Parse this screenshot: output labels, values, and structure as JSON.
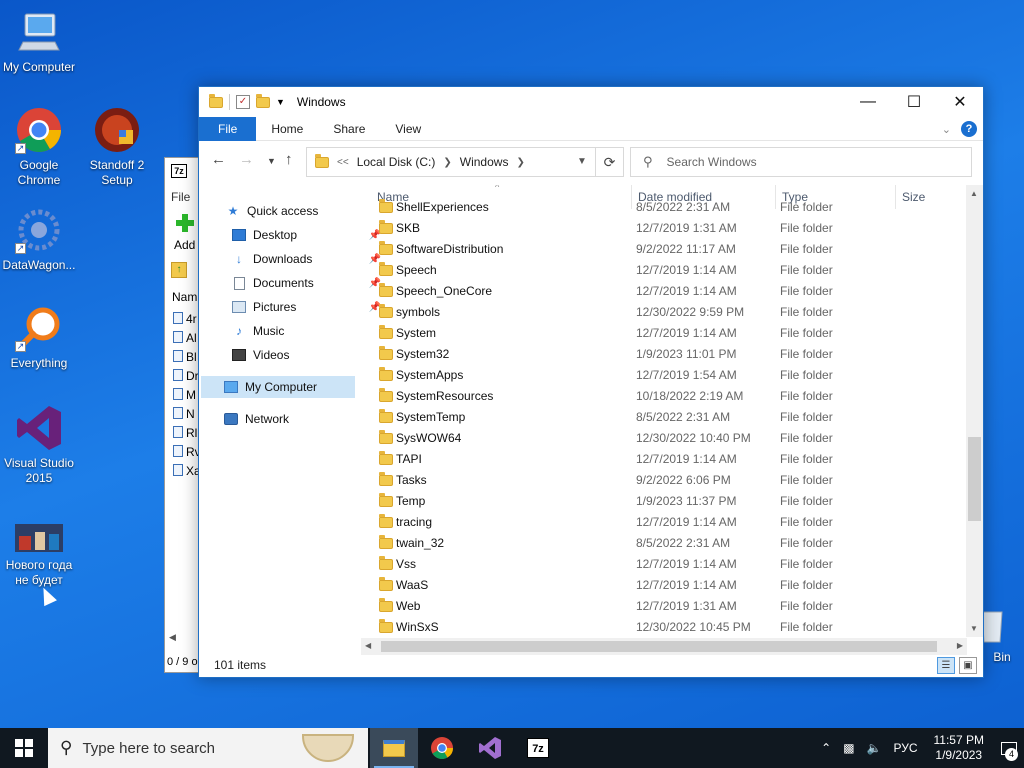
{
  "desktop": {
    "icons": [
      {
        "label": "My Computer"
      },
      {
        "label": "Google Chrome"
      },
      {
        "label": "Standoff 2 Setup"
      },
      {
        "label": "DataWagon..."
      },
      {
        "label": "Everything"
      },
      {
        "label": "Visual Studio 2015"
      },
      {
        "label": "Нового года не будет"
      }
    ],
    "recycle_partial": "Bin"
  },
  "bg_window": {
    "title_icon": "7z",
    "menu_file": "File",
    "add_label": "Add",
    "col_name": "Nam",
    "rows": [
      "4r",
      "Al",
      "Bl",
      "Dr",
      "M",
      "N",
      "Rl",
      "Rv",
      "Xa"
    ],
    "status": "0 / 9 o"
  },
  "explorer": {
    "title": "Windows",
    "tabs": {
      "file": "File",
      "home": "Home",
      "share": "Share",
      "view": "View"
    },
    "address": {
      "prefix": "<<",
      "crumb1": "Local Disk (C:)",
      "crumb2": "Windows"
    },
    "search_placeholder": "Search Windows",
    "nav": {
      "quick_access": "Quick access",
      "desktop": "Desktop",
      "downloads": "Downloads",
      "documents": "Documents",
      "pictures": "Pictures",
      "music": "Music",
      "videos": "Videos",
      "my_computer": "My Computer",
      "network": "Network"
    },
    "columns": {
      "name": "Name",
      "date": "Date modified",
      "type": "Type",
      "size": "Size"
    },
    "files": [
      {
        "name": "ShellExperiences",
        "date": "8/5/2022 2:31 AM",
        "type": "File folder"
      },
      {
        "name": "SKB",
        "date": "12/7/2019 1:31 AM",
        "type": "File folder"
      },
      {
        "name": "SoftwareDistribution",
        "date": "9/2/2022 11:17 AM",
        "type": "File folder"
      },
      {
        "name": "Speech",
        "date": "12/7/2019 1:14 AM",
        "type": "File folder"
      },
      {
        "name": "Speech_OneCore",
        "date": "12/7/2019 1:14 AM",
        "type": "File folder"
      },
      {
        "name": "symbols",
        "date": "12/30/2022 9:59 PM",
        "type": "File folder"
      },
      {
        "name": "System",
        "date": "12/7/2019 1:14 AM",
        "type": "File folder"
      },
      {
        "name": "System32",
        "date": "1/9/2023 11:01 PM",
        "type": "File folder"
      },
      {
        "name": "SystemApps",
        "date": "12/7/2019 1:54 AM",
        "type": "File folder"
      },
      {
        "name": "SystemResources",
        "date": "10/18/2022 2:19 AM",
        "type": "File folder"
      },
      {
        "name": "SystemTemp",
        "date": "8/5/2022 2:31 AM",
        "type": "File folder"
      },
      {
        "name": "SysWOW64",
        "date": "12/30/2022 10:40 PM",
        "type": "File folder"
      },
      {
        "name": "TAPI",
        "date": "12/7/2019 1:14 AM",
        "type": "File folder"
      },
      {
        "name": "Tasks",
        "date": "9/2/2022 6:06 PM",
        "type": "File folder"
      },
      {
        "name": "Temp",
        "date": "1/9/2023 11:37 PM",
        "type": "File folder"
      },
      {
        "name": "tracing",
        "date": "12/7/2019 1:14 AM",
        "type": "File folder"
      },
      {
        "name": "twain_32",
        "date": "8/5/2022 2:31 AM",
        "type": "File folder"
      },
      {
        "name": "Vss",
        "date": "12/7/2019 1:14 AM",
        "type": "File folder"
      },
      {
        "name": "WaaS",
        "date": "12/7/2019 1:14 AM",
        "type": "File folder"
      },
      {
        "name": "Web",
        "date": "12/7/2019 1:31 AM",
        "type": "File folder"
      },
      {
        "name": "WinSxS",
        "date": "12/30/2022 10:45 PM",
        "type": "File folder"
      }
    ],
    "status_count": "101 items"
  },
  "taskbar": {
    "search_placeholder": "Type here to search",
    "lang": "РУС",
    "time": "11:57 PM",
    "date": "1/9/2023",
    "notifications": "4"
  },
  "colors": {
    "accent": "#1a6fd0",
    "folder": "#f2c94c",
    "taskbar": "#101820"
  }
}
